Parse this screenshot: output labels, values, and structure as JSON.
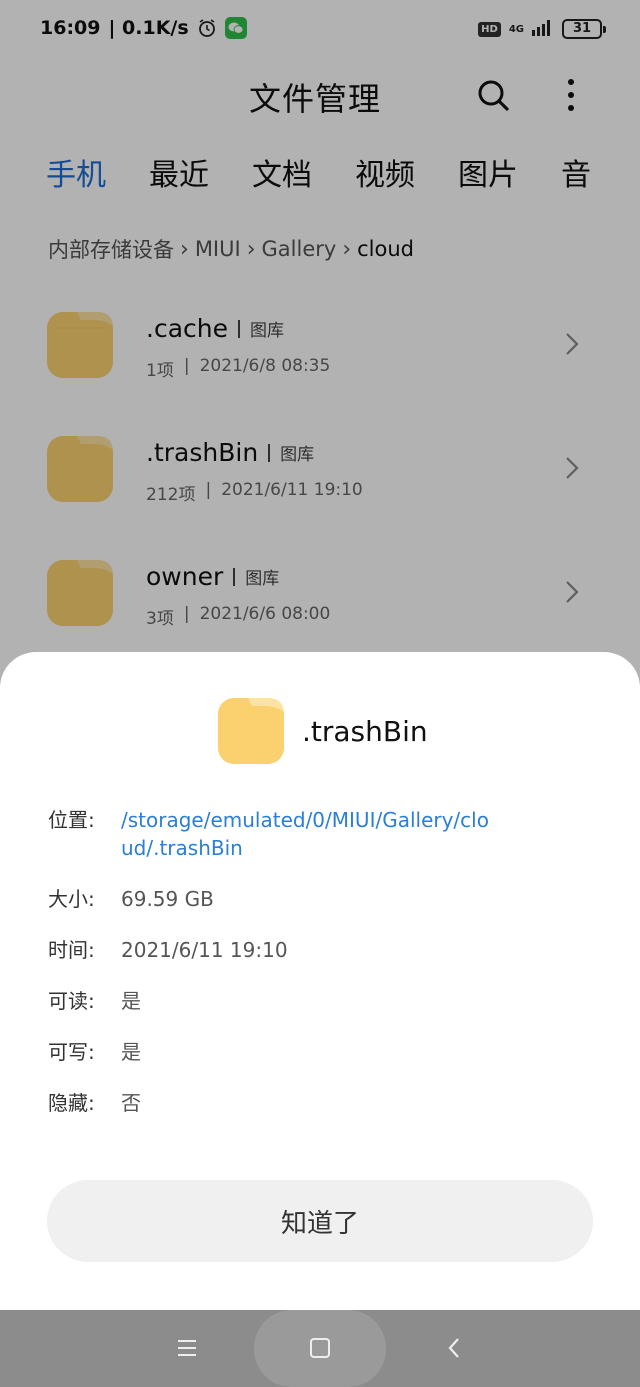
{
  "status_bar": {
    "time": "16:09",
    "speed": "| 0.1K/s",
    "hd": "HD",
    "network": "4G",
    "battery": "31"
  },
  "header": {
    "title": "文件管理",
    "search_icon": "search-icon",
    "more_icon": "more-vertical-icon"
  },
  "tabs": [
    {
      "label": "手机",
      "active": true
    },
    {
      "label": "最近"
    },
    {
      "label": "文档"
    },
    {
      "label": "视频"
    },
    {
      "label": "图片"
    },
    {
      "label": "音"
    }
  ],
  "breadcrumb": {
    "items": [
      "内部存储设备",
      "MIUI",
      "Gallery"
    ],
    "current": "cloud"
  },
  "files": [
    {
      "name": ".cache",
      "tag": "图库",
      "count": "1项",
      "date": "2021/6/8 08:35"
    },
    {
      "name": ".trashBin",
      "tag": "图库",
      "count": "212项",
      "date": "2021/6/11 19:10"
    },
    {
      "name": "owner",
      "tag": "图库",
      "count": "3项",
      "date": "2021/6/6 08:00"
    }
  ],
  "sheet": {
    "title": ".trashBin",
    "location_label": "位置:",
    "location_value": "/storage/emulated/0/MIUI/Gallery/cloud/.trashBin",
    "size_label": "大小:",
    "size_value": "69.59 GB",
    "time_label": "时间:",
    "time_value": "2021/6/11 19:10",
    "readable_label": "可读:",
    "readable_value": "是",
    "writable_label": "可写:",
    "writable_value": "是",
    "hidden_label": "隐藏:",
    "hidden_value": "否",
    "button_label": "知道了"
  },
  "colors": {
    "accent": "#1e6fd9",
    "link": "#2a7fd6",
    "folder": "#fbd170"
  }
}
